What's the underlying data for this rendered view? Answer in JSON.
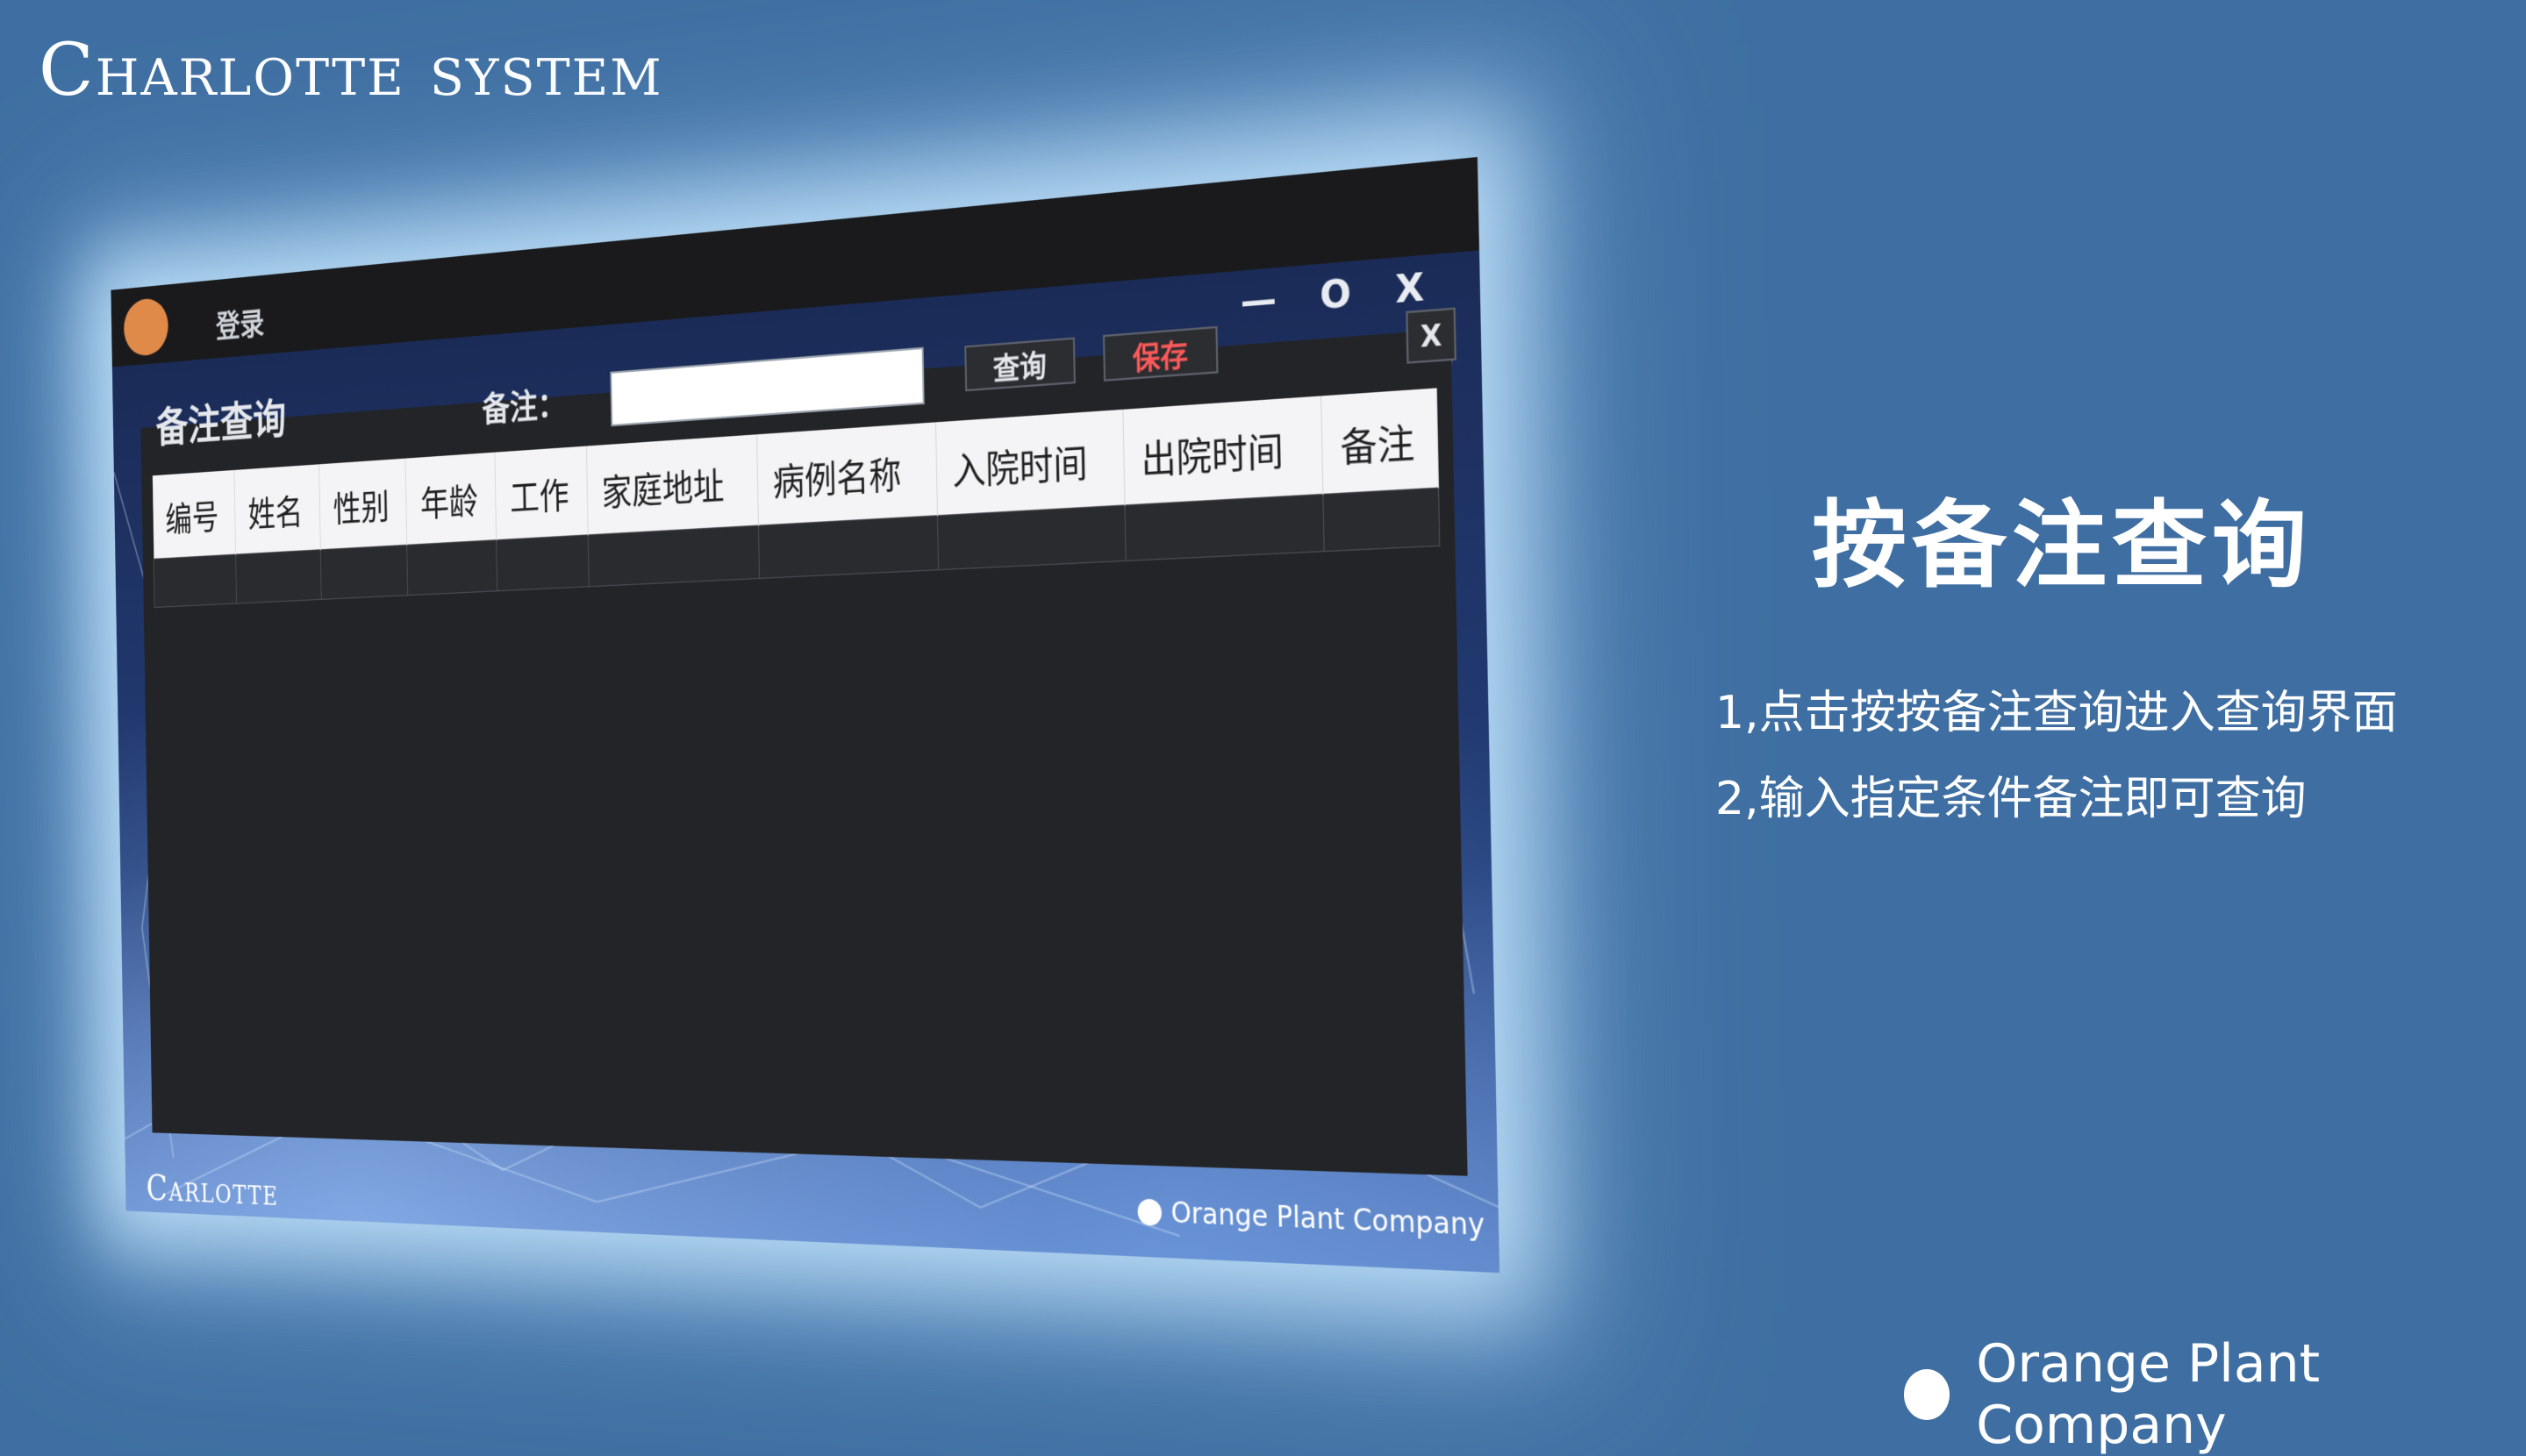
{
  "slide": {
    "brand_title": "Charlotte system",
    "heading": "按备注查询",
    "steps": [
      "1,点击按按备注查询进入查询界面",
      "2,输入指定条件备注即可查询"
    ],
    "company": "Orange Plant Company"
  },
  "app": {
    "title_bar": {
      "login_label": "登录",
      "controls": "— O X"
    },
    "panel": {
      "heading": "备注查询",
      "remark_label": "备注：",
      "remark_value": "",
      "query_button": "查询",
      "save_button": "保存",
      "close_button": "X"
    },
    "table": {
      "columns": [
        "编号",
        "姓名",
        "性别",
        "年龄",
        "工作",
        "家庭地址",
        "病例名称",
        "入院时间",
        "出院时间",
        "备注"
      ],
      "rows": [
        [
          "",
          "",
          "",
          "",
          "",
          "",
          "",
          "",
          "",
          ""
        ]
      ]
    },
    "footer_company": "Orange Plant Company",
    "app_brand": "Carlotte"
  },
  "colors": {
    "background": "#3f6fa2",
    "window": "#1e1f22",
    "logo_orange": "#e08a4a",
    "save_red": "#ff5a5a",
    "glow": "#c8e8ff"
  }
}
